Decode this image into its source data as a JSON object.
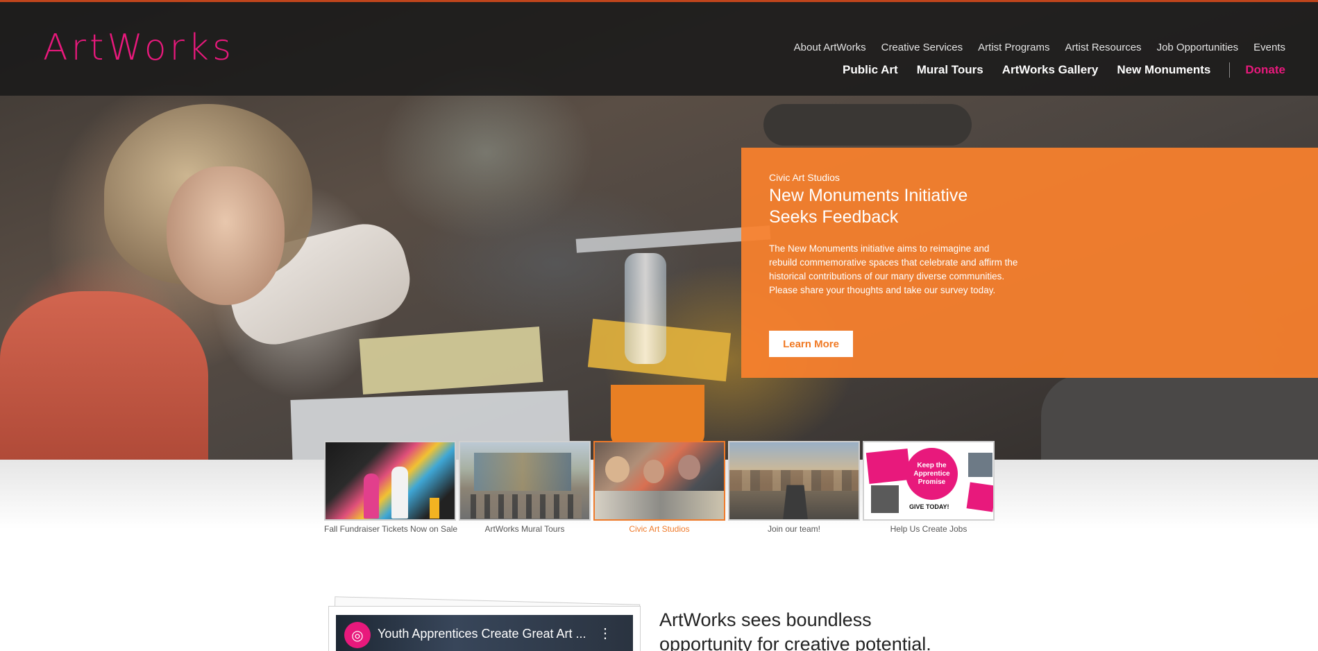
{
  "brand": {
    "logo_text": "ArtWorks",
    "logo_color": "#e8197c",
    "accent_orange": "#fa812d"
  },
  "top_nav": [
    "About ArtWorks",
    "Creative Services",
    "Artist Programs",
    "Artist Resources",
    "Job Opportunities",
    "Events"
  ],
  "main_nav": [
    "Public Art",
    "Mural Tours",
    "ArtWorks Gallery",
    "New Monuments"
  ],
  "donate_label": "Donate",
  "feature": {
    "kicker": "Civic Art Studios",
    "title": "New Monuments Initiative Seeks Feedback",
    "body": "The New Monuments initiative aims to reimagine and rebuild commemorative spaces that celebrate and affirm the historical contributions of our many diverse communities. Please share your thoughts and take our survey today.",
    "button_label": "Learn More"
  },
  "thumbnails": [
    {
      "caption": "Fall Fundraiser Tickets Now on Sale",
      "active": false
    },
    {
      "caption": "ArtWorks Mural Tours",
      "active": false
    },
    {
      "caption": "Civic Art Studios",
      "active": true
    },
    {
      "caption": "Join our team!",
      "active": false
    },
    {
      "caption": "Help Us Create Jobs",
      "active": false,
      "graphic_text": "Keep the Apprentice Promise",
      "graphic_subtext": "GIVE TODAY!"
    }
  ],
  "video": {
    "title": "Youth Apprentices Create Great Art ...",
    "channel_icon": "swirl-icon",
    "menu_icon": "kebab-icon"
  },
  "intro_text": "ArtWorks sees boundless opportunity for creative potential. Our city comes"
}
